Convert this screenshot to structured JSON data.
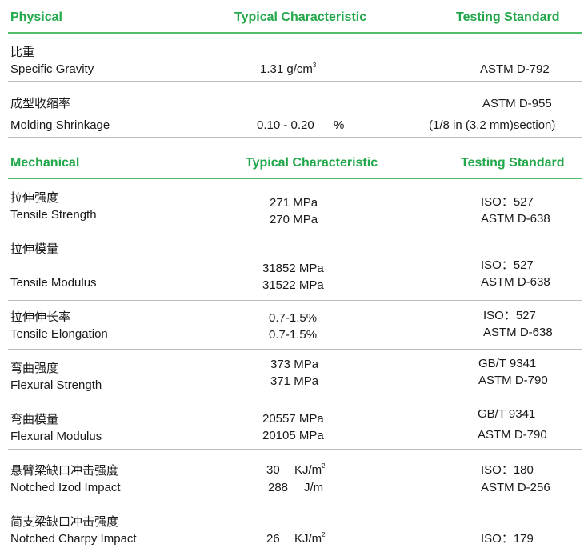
{
  "physical": {
    "header": {
      "section": "Physical",
      "typical": "Typical Characteristic",
      "standard": "Testing Standard"
    },
    "rows": [
      {
        "cn": "比重",
        "en": "Specific Gravity",
        "value": "1.31 g/cm",
        "value_sup": "3",
        "std": "ASTM D-792"
      },
      {
        "cn": "成型收缩率",
        "en": "Molding Shrinkage",
        "value": "0.10 - 0.20",
        "unit": "%",
        "std1": "ASTM D-955",
        "std2": "(1/8 in (3.2 mm)section)"
      }
    ]
  },
  "mechanical": {
    "header": {
      "section": "Mechanical",
      "typical": "Typical Characteristic",
      "standard": "Testing Standard"
    },
    "rows": [
      {
        "cn": "拉伸强度",
        "en": "Tensile Strength",
        "v1": "271 MPa",
        "v2": "270 MPa",
        "s1": "ISO：527",
        "s2": "ASTM D-638"
      },
      {
        "cn": "拉伸模量",
        "en": "Tensile Modulus",
        "v1": "31852 MPa",
        "v2": "31522 MPa",
        "s1": "ISO：527",
        "s2": "ASTM D-638"
      },
      {
        "cn": "拉伸伸长率",
        "en": "Tensile Elongation",
        "v1": "0.7-1.5%",
        "v2": "0.7-1.5%",
        "s1": "ISO：527",
        "s2": "ASTM D-638"
      },
      {
        "cn": "弯曲强度",
        "en": "Flexural Strength",
        "v1": "373 MPa",
        "v2": "371 MPa",
        "s1": "GB/T 9341",
        "s2": "ASTM D-790"
      },
      {
        "cn": "弯曲模量",
        "en": "Flexural Modulus",
        "v1": "20557 MPa",
        "v2": "20105 MPa",
        "s1": "GB/T 9341",
        "s2": "ASTM D-790"
      },
      {
        "cn": "悬臂梁缺口冲击强度",
        "en": "Notched Izod Impact",
        "v1_num": "30",
        "v1_unit": "KJ/m",
        "v1_sup": "2",
        "v2_num": "288",
        "v2_unit": "J/m",
        "s1": "ISO：180",
        "s2": "ASTM D-256"
      },
      {
        "cn": "简支梁缺口冲击强度",
        "en": "Notched Charpy Impact",
        "v1_num": "26",
        "v1_unit": "KJ/m",
        "v1_sup": "2",
        "s1": "ISO：179"
      }
    ]
  }
}
